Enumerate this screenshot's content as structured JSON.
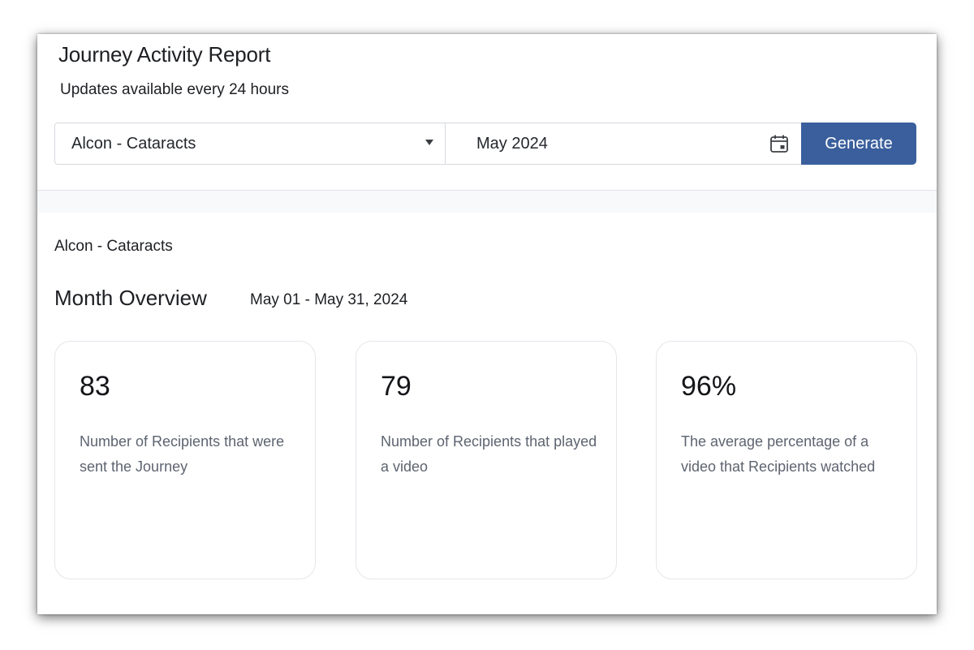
{
  "header": {
    "title": "Journey Activity Report",
    "subtitle": "Updates available every 24 hours"
  },
  "controls": {
    "journey_select_value": "Alcon - Cataracts",
    "month_value": "May 2024",
    "generate_label": "Generate"
  },
  "report": {
    "journey_name": "Alcon - Cataracts",
    "overview_title": "Month Overview",
    "overview_range": "May 01 - May 31, 2024",
    "cards": [
      {
        "value": "83",
        "description": "Number of Recipients that were sent the Journey"
      },
      {
        "value": "79",
        "description": "Number of Recipients that played a video"
      },
      {
        "value": "96%",
        "description": "The average percentage of a video that Recipients watched"
      }
    ]
  },
  "colors": {
    "accent": "#3a5f9c",
    "muted_text": "#5d6470",
    "border": "#e3e6ea"
  },
  "icons": {
    "select": "chevron-down-icon",
    "date": "calendar-icon"
  }
}
